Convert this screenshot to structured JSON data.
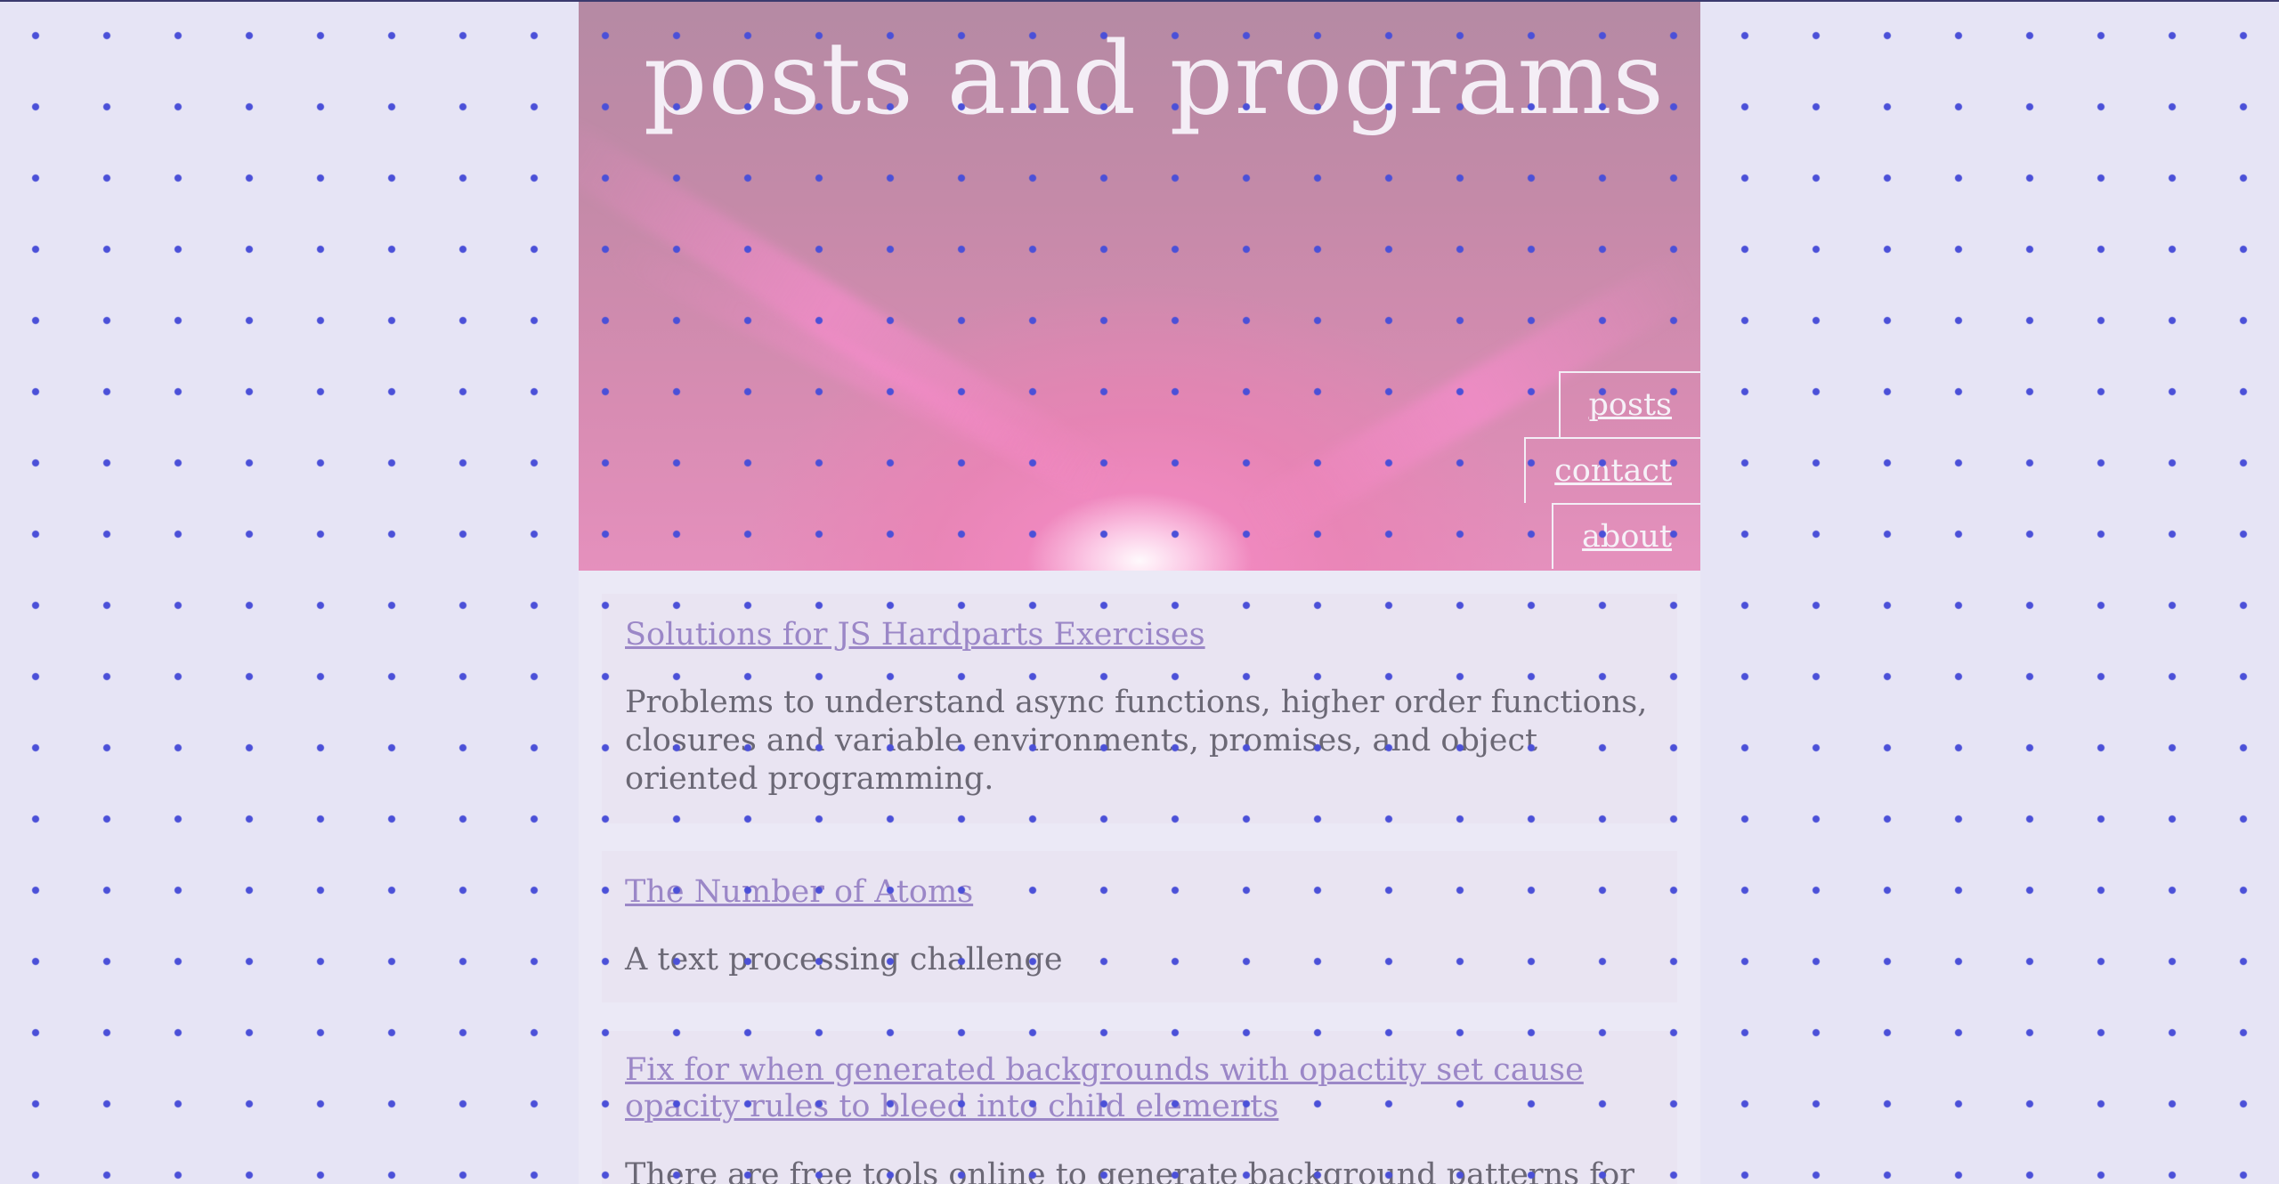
{
  "site": {
    "title": "posts and programs"
  },
  "nav": {
    "items": [
      {
        "label": "posts"
      },
      {
        "label": "contact"
      },
      {
        "label": "about"
      }
    ]
  },
  "posts": [
    {
      "title": "Solutions for JS Hardparts Exercises",
      "description": "Problems to understand async functions, higher order functions, closures and variable environments, promises, and object oriented programming."
    },
    {
      "title": "The Number of Atoms",
      "description": "A text processing challenge"
    },
    {
      "title": "Fix for when generated backgrounds with opactity set cause opacity rules to bleed into child elements",
      "description": "There are free tools online to generate background patterns for"
    }
  ],
  "colors": {
    "page_background": "#e6e4f5",
    "dot_color": "#4b50d8",
    "link_color": "#9b87c7",
    "text_color": "#6b6875",
    "header_text": "#f4eef6"
  }
}
